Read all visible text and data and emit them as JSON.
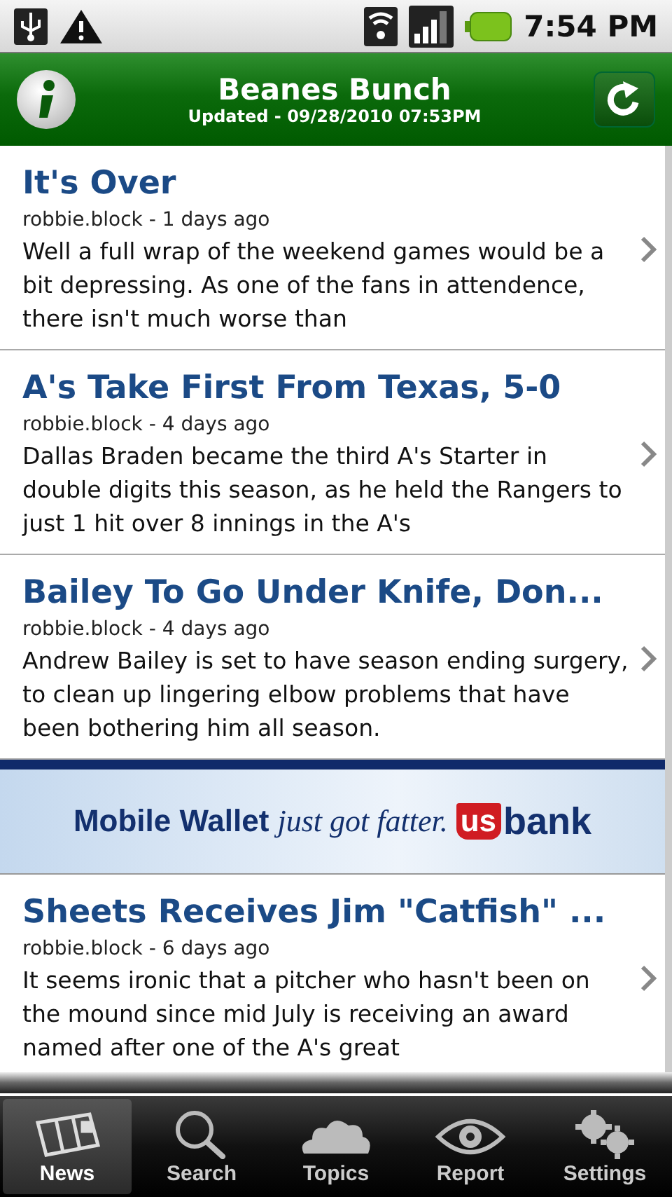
{
  "status_bar": {
    "time": "7:54 PM"
  },
  "header": {
    "title": "Beanes Bunch",
    "subtitle": "Updated - 09/28/2010 07:53PM"
  },
  "articles": [
    {
      "title": "It's Over",
      "author": "robbie.block",
      "age": "- 1 days ago",
      "snippet": "Well a full wrap of the weekend games would be a bit depressing.  As one of the fans in attendence, there isn't much worse than"
    },
    {
      "title": "A's Take First From Texas, 5-0",
      "author": "robbie.block",
      "age": "- 4 days ago",
      "snippet": "Dallas Braden became the third A's Starter in double digits this season, as he held the Rangers to just 1 hit over 8 innings in the A's"
    },
    {
      "title": "Bailey To Go Under Knife, Don...",
      "author": "robbie.block",
      "age": "- 4 days ago",
      "snippet": "Andrew Bailey is set to have season ending surgery, to clean up lingering elbow problems that have been bothering him all season."
    },
    {
      "kind": "ad",
      "headline": "Mobile Wallet",
      "tagline": "just got fatter.",
      "badge": "us",
      "brand": "bank"
    },
    {
      "title": "Sheets Receives Jim \"Catfish\" ...",
      "author": "robbie.block",
      "age": "- 6 days ago",
      "snippet": "It seems ironic that a pitcher who hasn't been on the mound since mid July is receiving an award named after one of the A's great"
    }
  ],
  "tabs": [
    {
      "label": "News",
      "kind": "news",
      "selected": true
    },
    {
      "label": "Search",
      "kind": "search",
      "selected": false
    },
    {
      "label": "Topics",
      "kind": "topics",
      "selected": false
    },
    {
      "label": "Report",
      "kind": "report",
      "selected": false
    },
    {
      "label": "Settings",
      "kind": "settings",
      "selected": false
    }
  ]
}
